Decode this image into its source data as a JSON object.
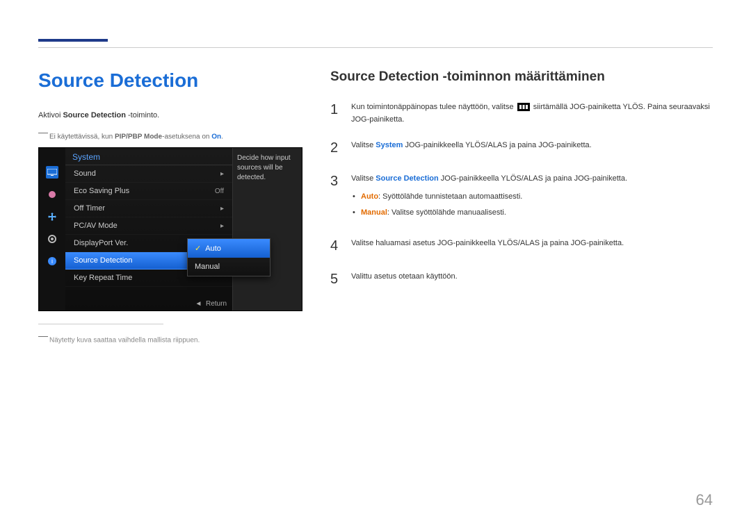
{
  "header_title": "Source Detection",
  "activate": {
    "pre": "Aktivoi ",
    "bold": "Source Detection",
    "post": " -toiminto."
  },
  "note1": {
    "pre": "Ei käytettävissä, kun ",
    "bold": "PIP/PBP Mode",
    "mid": "-asetuksena on ",
    "on": "On",
    "post": "."
  },
  "osd": {
    "tab": "System",
    "desc": "Decide how input sources will be detected.",
    "rows": [
      {
        "label": "Sound",
        "value": "",
        "arrow": true
      },
      {
        "label": "Eco Saving Plus",
        "value": "Off",
        "arrow": false
      },
      {
        "label": "Off Timer",
        "value": "",
        "arrow": true
      },
      {
        "label": "PC/AV Mode",
        "value": "",
        "arrow": true
      },
      {
        "label": "DisplayPort Ver.",
        "value": "",
        "arrow": false
      },
      {
        "label": "Source Detection",
        "value": "",
        "arrow": false,
        "selected": true
      },
      {
        "label": "Key Repeat Time",
        "value": "",
        "arrow": false
      }
    ],
    "popup": [
      "Auto",
      "Manual"
    ],
    "return": "Return"
  },
  "disclaimer": "Näytetty kuva saattaa vaihdella mallista riippuen.",
  "right": {
    "subtitle": "Source Detection -toiminnon määrittäminen",
    "steps": {
      "s1_pre": "Kun toimintonäppäinopas tulee näyttöön, valitse ",
      "s1_post": " siirtämällä JOG-painiketta YLÖS. Paina seuraavaksi JOG-painiketta.",
      "s2_pre": "Valitse ",
      "s2_hl": "System",
      "s2_post": " JOG-painikkeella YLÖS/ALAS ja paina JOG-painiketta.",
      "s3_pre": "Valitse ",
      "s3_hl": "Source Detection",
      "s3_post": " JOG-painikkeella YLÖS/ALAS ja paina JOG-painiketta.",
      "b1_hl": "Auto",
      "b1_post": ": Syöttölähde tunnistetaan automaattisesti.",
      "b2_hl": "Manual",
      "b2_post": ": Valitse syöttölähde manuaalisesti.",
      "s4": "Valitse haluamasi asetus JOG-painikkeella YLÖS/ALAS ja paina JOG-painiketta.",
      "s5": "Valittu asetus otetaan käyttöön."
    }
  },
  "page_number": "64"
}
